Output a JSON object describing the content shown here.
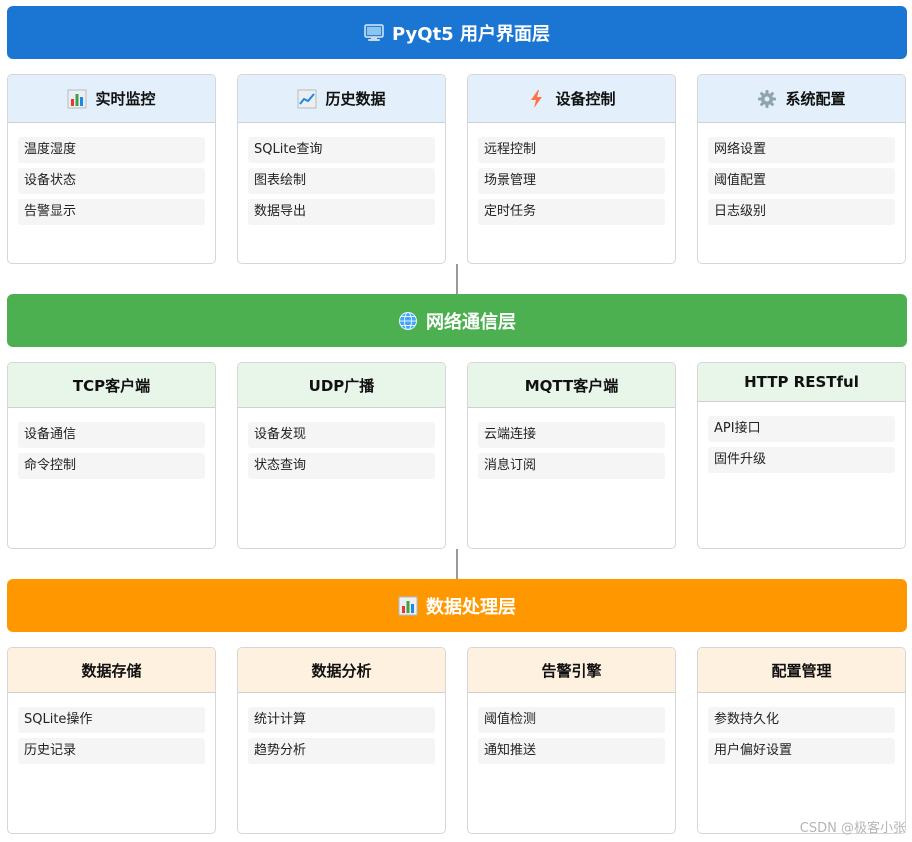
{
  "colors": {
    "ui_layer": "#1a76d2",
    "network_layer": "#4caf50",
    "data_layer": "#ff9800",
    "ui_card_head": "#e3f0fb",
    "network_card_head": "#e8f5e9",
    "data_card_head": "#fff1e0"
  },
  "layers": [
    {
      "title": "PyQt5 用户界面层",
      "icon": "computer-icon",
      "cards": [
        {
          "title": "实时监控",
          "icon": "bar-chart-icon",
          "items": [
            "温度湿度",
            "设备状态",
            "告警显示"
          ]
        },
        {
          "title": "历史数据",
          "icon": "line-chart-icon",
          "items": [
            "SQLite查询",
            "图表绘制",
            "数据导出"
          ]
        },
        {
          "title": "设备控制",
          "icon": "lightning-icon",
          "items": [
            "远程控制",
            "场景管理",
            "定时任务"
          ]
        },
        {
          "title": "系统配置",
          "icon": "gear-icon",
          "items": [
            "网络设置",
            "阈值配置",
            "日志级别"
          ]
        }
      ]
    },
    {
      "title": "网络通信层",
      "icon": "globe-icon",
      "cards": [
        {
          "title": "TCP客户端",
          "items": [
            "设备通信",
            "命令控制"
          ]
        },
        {
          "title": "UDP广播",
          "items": [
            "设备发现",
            "状态查询"
          ]
        },
        {
          "title": "MQTT客户端",
          "items": [
            "云端连接",
            "消息订阅"
          ]
        },
        {
          "title": "HTTP RESTful",
          "items": [
            "API接口",
            "固件升级"
          ]
        }
      ]
    },
    {
      "title": "数据处理层",
      "icon": "bar-chart-icon",
      "cards": [
        {
          "title": "数据存储",
          "items": [
            "SQLite操作",
            "历史记录"
          ]
        },
        {
          "title": "数据分析",
          "items": [
            "统计计算",
            "趋势分析"
          ]
        },
        {
          "title": "告警引擎",
          "items": [
            "阈值检测",
            "通知推送"
          ]
        },
        {
          "title": "配置管理",
          "items": [
            "参数持久化",
            "用户偏好设置"
          ]
        }
      ]
    }
  ],
  "watermark": "CSDN @极客小张"
}
